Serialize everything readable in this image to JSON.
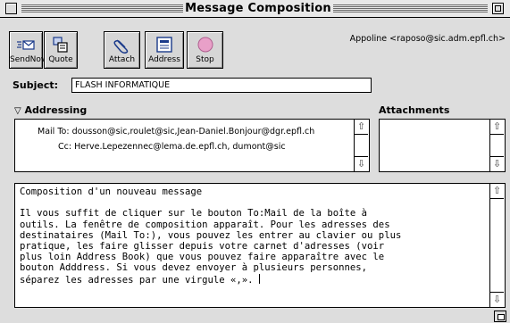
{
  "window": {
    "title": "Message Composition"
  },
  "toolbar": {
    "send_now": "SendNow",
    "quote": "Quote",
    "attach": "Attach",
    "address": "Address",
    "stop": "Stop"
  },
  "sender": "Appoline <raposo@sic.adm.epfl.ch>",
  "subject": {
    "label": "Subject:",
    "value": "FLASH INFORMATIQUE"
  },
  "addressing": {
    "header": "Addressing",
    "mail_to_label": "Mail To:",
    "mail_to_value": "dousson@sic,roulet@sic,Jean-Daniel.Bonjour@dgr.epfl.ch",
    "cc_label": "Cc:",
    "cc_value": "Herve.Lepezennec@lema.de.epfl.ch, dumont@sic"
  },
  "attachments": {
    "header": "Attachments"
  },
  "body": {
    "lines": [
      "Composition d'un nouveau message",
      "",
      "Il vous suffit de cliquer sur le bouton To:Mail de la boîte à",
      "outils. La fenêtre de composition apparaît. Pour les adresses des",
      "destinataires (Mail To:), vous pouvez les entrer au clavier ou plus",
      "pratique, les faire glisser depuis votre carnet d'adresses (voir",
      "plus loin Address Book) que vous pouvez faire apparaître avec le",
      "bouton Adddress. Si vous devez envoyer à plusieurs personnes,",
      "séparez les adresses par une virgule «,». "
    ]
  },
  "colors": {
    "stop_icon": "#e8a0c8",
    "disabled_text": "#777777"
  }
}
